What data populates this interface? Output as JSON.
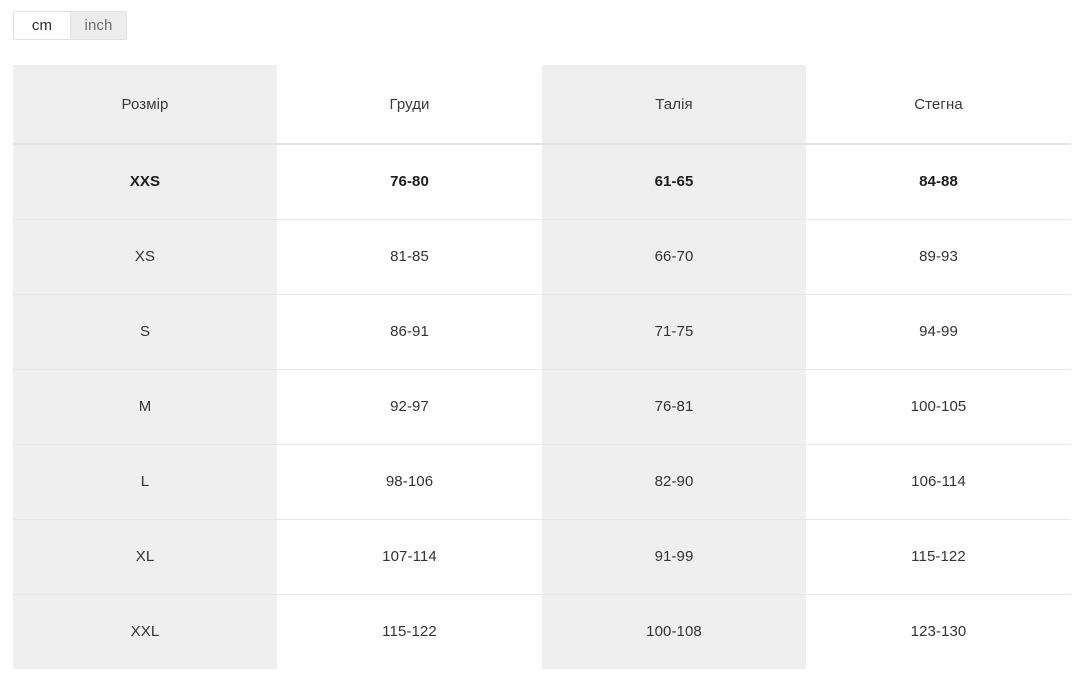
{
  "unit_toggle": {
    "options": [
      {
        "label": "cm",
        "active": true
      },
      {
        "label": "inch",
        "active": false
      }
    ],
    "selected": "cm"
  },
  "size_table": {
    "columns": [
      "Розмір",
      "Груди",
      "Талія",
      "Стегна"
    ],
    "rows": [
      {
        "size": "XXS",
        "chest": "76-80",
        "waist": "61-65",
        "hips": "84-88",
        "emphasis": true
      },
      {
        "size": "XS",
        "chest": "81-85",
        "waist": "66-70",
        "hips": "89-93",
        "emphasis": false
      },
      {
        "size": "S",
        "chest": "86-91",
        "waist": "71-75",
        "hips": "94-99",
        "emphasis": false
      },
      {
        "size": "M",
        "chest": "92-97",
        "waist": "76-81",
        "hips": "100-105",
        "emphasis": false
      },
      {
        "size": "L",
        "chest": "98-106",
        "waist": "82-90",
        "hips": "106-114",
        "emphasis": false
      },
      {
        "size": "XL",
        "chest": "107-114",
        "waist": "91-99",
        "hips": "115-122",
        "emphasis": false
      },
      {
        "size": "XXL",
        "chest": "115-122",
        "waist": "100-108",
        "hips": "123-130",
        "emphasis": false
      }
    ]
  },
  "colors": {
    "shaded_cell": "#efefef",
    "plain_cell": "#ffffff",
    "row_border": "#e8e8e8",
    "text": "#333333",
    "toggle_inactive_bg": "#ededed",
    "toggle_active_bg": "#ffffff"
  }
}
